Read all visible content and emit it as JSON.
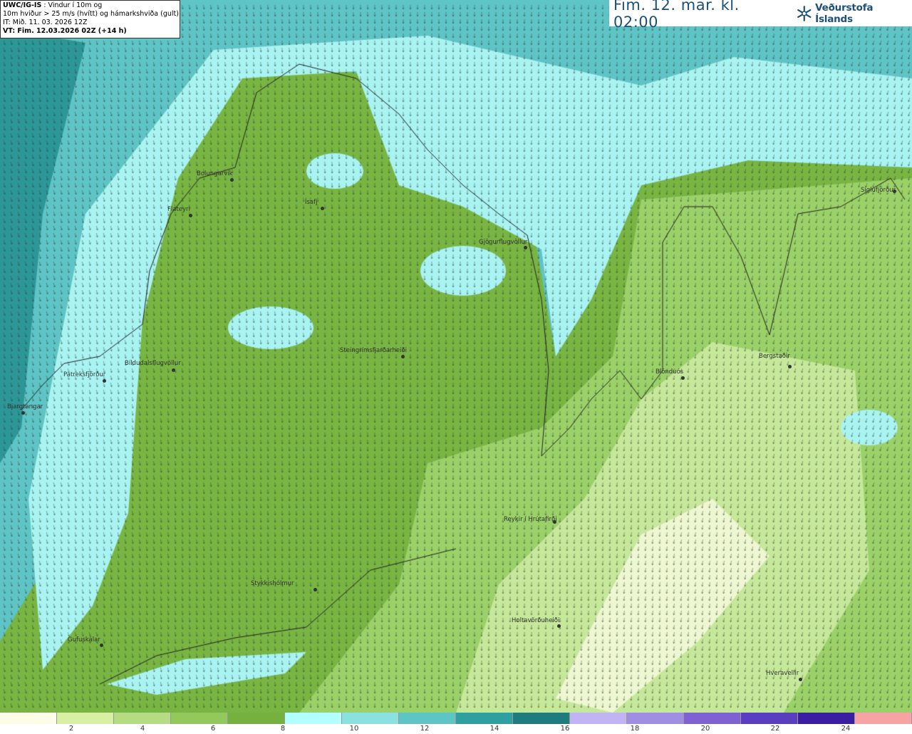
{
  "info": {
    "model": "UWC/IG-IS",
    "title_rest": " : Vindur í 10m og",
    "line2": "10m hviður > 25 m/s (hvítt) og hámarkshviða (gult)",
    "it": "IT: Mið. 11. 03. 2026 12Z",
    "vt": "VT: Fim. 12.03.2026 02Z (+14 h)"
  },
  "header": {
    "time_label": "Fim. 12. mar. kl. 02:00",
    "brand": "Veðurstofa Íslands",
    "brand_icon": "snowflake-logo-icon"
  },
  "places": [
    {
      "name": "Bolungarvík"
    },
    {
      "name": "Flateyri"
    },
    {
      "name": "Ísafj"
    },
    {
      "name": "Gjögurflugvöllur"
    },
    {
      "name": "Siglufjörður"
    },
    {
      "name": "Steingrímsfjarðarheiði"
    },
    {
      "name": "Bíldudalsflugvöllur"
    },
    {
      "name": "Patreksfjörður"
    },
    {
      "name": "Bjargtangar"
    },
    {
      "name": "Blönduós"
    },
    {
      "name": "Bergstaðir"
    },
    {
      "name": "Reykir í Hrútafirði"
    },
    {
      "name": "Stykkishólmur"
    },
    {
      "name": "Holtavörðuheiði"
    },
    {
      "name": "Gufuskálar"
    },
    {
      "name": "Hveravellir"
    }
  ],
  "legend": {
    "unit_colors": [
      "#fbfde6",
      "#d9f0a3",
      "#b5dc82",
      "#93c95c",
      "#74b13e",
      "#b2ffff",
      "#8be0e0",
      "#5ec4c4",
      "#2f9fa0",
      "#1f7c7e",
      "#c0b4f3",
      "#a08ee3",
      "#7e62d2",
      "#5a3ec0",
      "#3a1ea2",
      "#f7a3a3"
    ],
    "ticks": [
      "2",
      "4",
      "6",
      "8",
      "10",
      "12",
      "14",
      "16",
      "18",
      "20",
      "22",
      "24"
    ]
  }
}
